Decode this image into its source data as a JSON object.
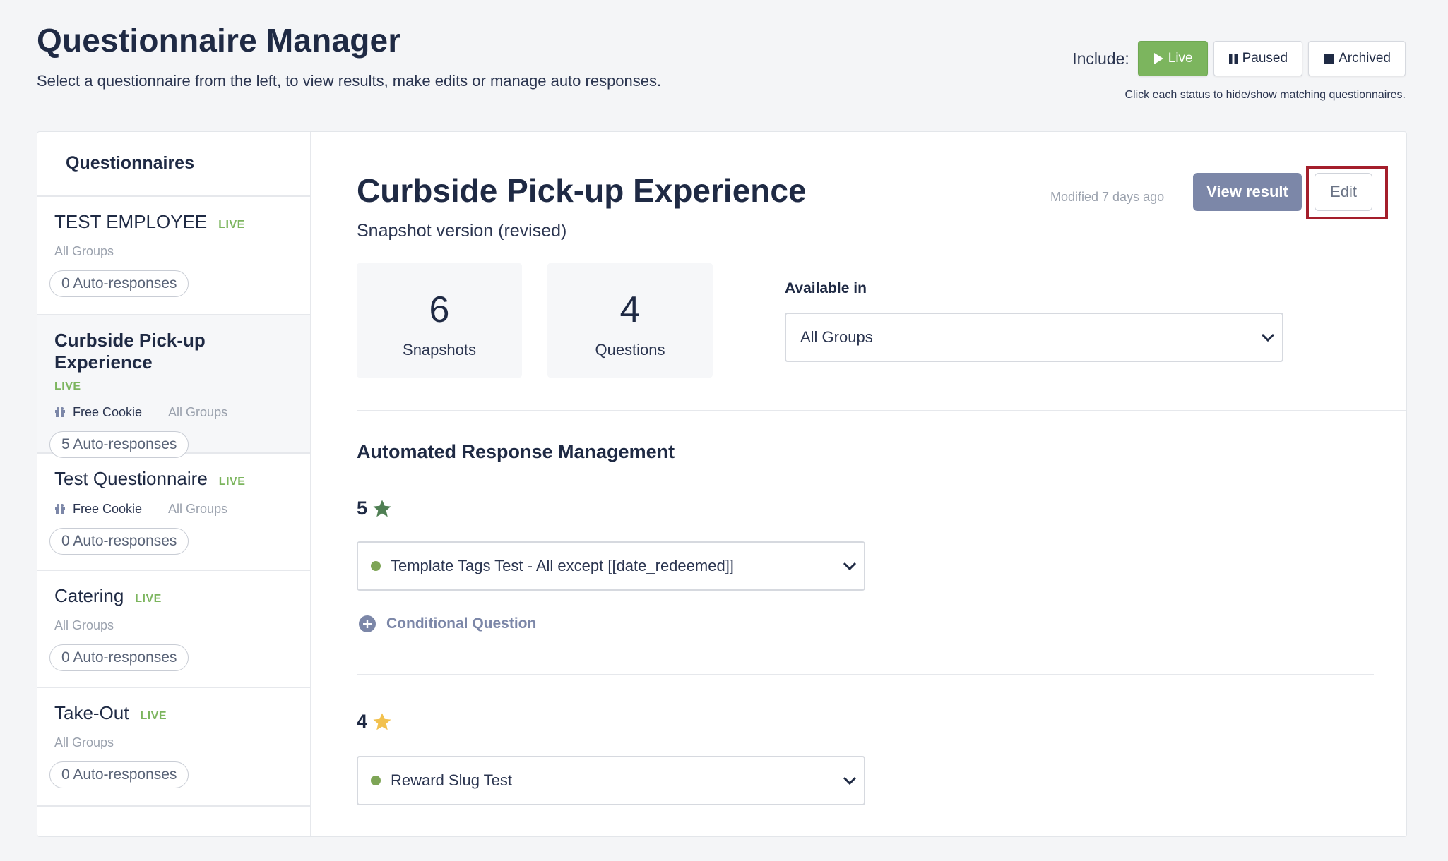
{
  "header": {
    "title": "Questionnaire Manager",
    "subtitle": "Select a questionnaire from the left, to view results, make edits or manage auto responses."
  },
  "include": {
    "label": "Include:",
    "live": "Live",
    "paused": "Paused",
    "archived": "Archived",
    "hint": "Click each status to hide/show matching questionnaires."
  },
  "sidebar": {
    "title": "Questionnaires",
    "items": [
      {
        "name": "TEST EMPLOYEE",
        "status": "LIVE",
        "groups": "All Groups",
        "reward": "",
        "auto": "0 Auto-responses"
      },
      {
        "name": "Curbside Pick-up Experience",
        "status": "LIVE",
        "groups": "All Groups",
        "reward": "Free Cookie",
        "auto": "5 Auto-responses"
      },
      {
        "name": "Test Questionnaire",
        "status": "LIVE",
        "groups": "All Groups",
        "reward": "Free Cookie",
        "auto": "0 Auto-responses"
      },
      {
        "name": "Catering",
        "status": "LIVE",
        "groups": "All Groups",
        "reward": "",
        "auto": "0 Auto-responses"
      },
      {
        "name": "Take-Out",
        "status": "LIVE",
        "groups": "All Groups",
        "reward": "",
        "auto": "0 Auto-responses"
      }
    ]
  },
  "main": {
    "title": "Curbside Pick-up Experience",
    "modified": "Modified 7 days ago",
    "version": "Snapshot version (revised)",
    "view_result": "View result",
    "edit": "Edit",
    "stats": [
      {
        "value": "6",
        "label": "Snapshots"
      },
      {
        "value": "4",
        "label": "Questions"
      }
    ],
    "available_label": "Available in",
    "available_value": "All Groups",
    "section_title": "Automated Response Management",
    "ratings": [
      {
        "value": "5",
        "star_color": "#4f7f53",
        "template": "Template Tags Test - All except [[date_redeemed]]"
      },
      {
        "value": "4",
        "star_color": "#f2c14e",
        "template": "Reward Slug Test"
      }
    ],
    "conditional": "Conditional Question"
  },
  "colors": {
    "live_green": "#7cb55e",
    "highlight_red": "#a41e2b",
    "view_button": "#7c87a8"
  }
}
